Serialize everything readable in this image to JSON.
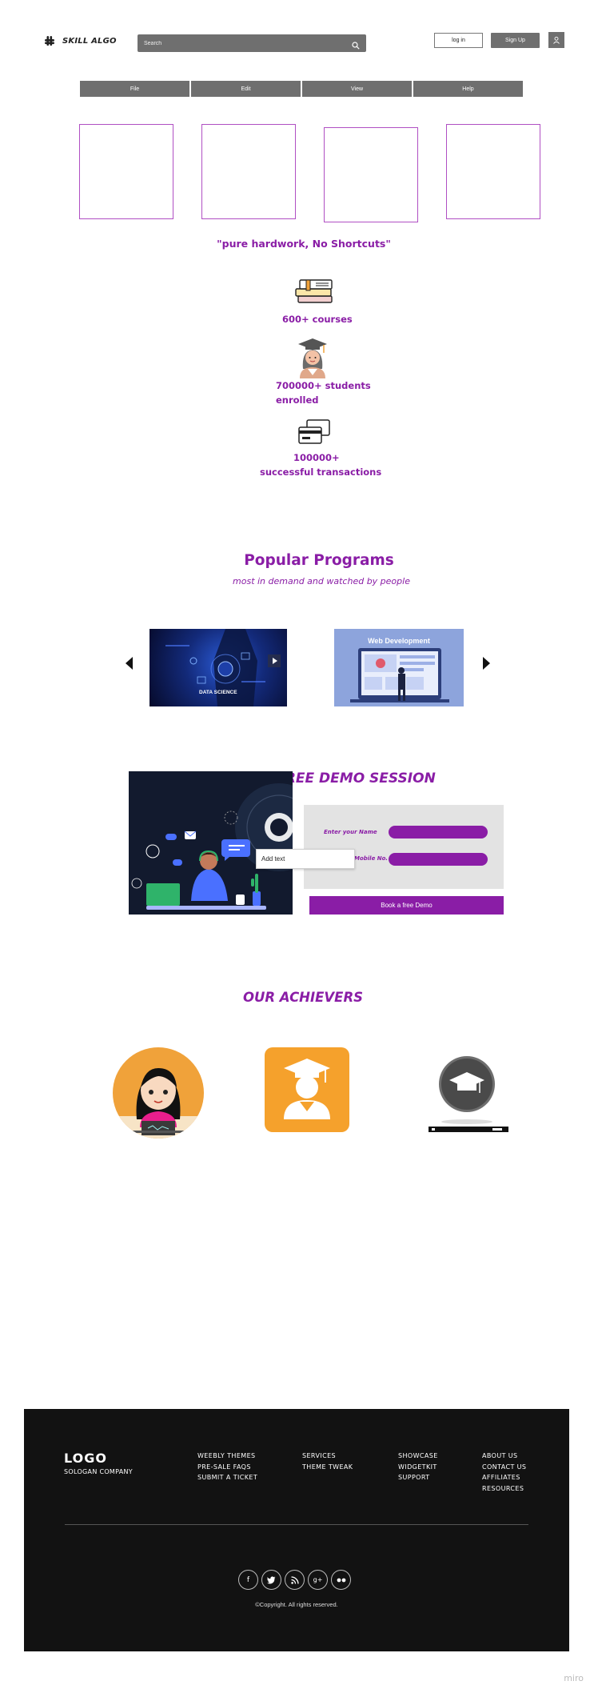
{
  "header": {
    "brand": "SKILL ALGO",
    "search_placeholder": "Search",
    "login_label": "log in",
    "signup_label": "Sign Up"
  },
  "menu": [
    "File",
    "Edit",
    "View",
    "Help"
  ],
  "quote": "\"pure hardwork, No Shortcuts\"",
  "stats": {
    "courses": "600+ courses",
    "students_line1": "700000+ students",
    "students_line2": "enrolled",
    "transactions_line1": "100000+",
    "transactions_line2": "successful transactions"
  },
  "programs": {
    "title": "Popular Programs",
    "subtitle": "most in demand and watched by people",
    "card1_title": "DATA SCIENCE",
    "card2_title": "Web Development"
  },
  "demo": {
    "title": "BOOK A FREE DEMO SESSION",
    "name_label": "Enter your Name",
    "mobile_label": "Mobile No.",
    "add_text": "Add text",
    "button": "Book a free Demo"
  },
  "achievers": {
    "title": "OUR ACHIEVERS"
  },
  "footer": {
    "logo": "LOGO",
    "slogan": "SOLOGAN COMPANY",
    "col1": [
      "WEEBLY THEMES",
      "PRE-SALE FAQS",
      "SUBMIT A TICKET"
    ],
    "col2": [
      "SERVICES",
      "THEME TWEAK"
    ],
    "col3": [
      "SHOWCASE",
      "WIDGETKIT",
      "SUPPORT"
    ],
    "col4": [
      "ABOUT US",
      "CONTACT US",
      "AFFILIATES",
      "RESOURCES"
    ],
    "socials": [
      "facebook-icon",
      "twitter-icon",
      "rss-icon",
      "google-plus-icon",
      "flickr-icon"
    ],
    "copyright": "©Copyright. All rights reserved."
  },
  "watermark": "miro",
  "colors": {
    "accent": "#8a1da6",
    "frame": "#b04fc3",
    "gray": "#6f6f6f",
    "footer": "#121212"
  }
}
